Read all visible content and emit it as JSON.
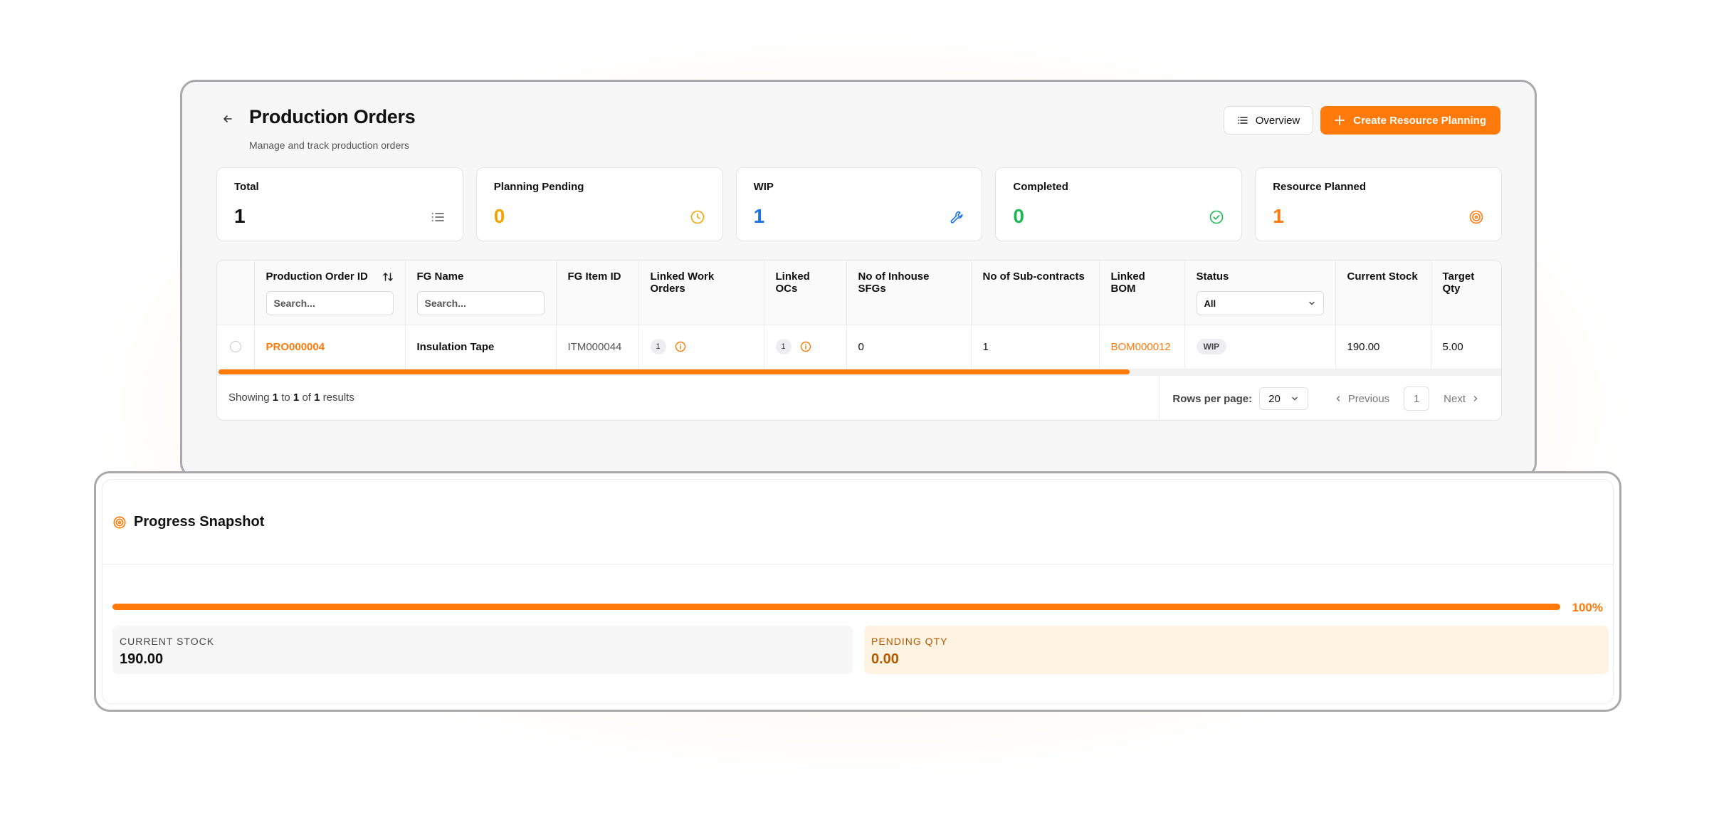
{
  "header": {
    "title": "Production Orders",
    "subtitle": "Manage and track production orders",
    "overview_label": "Overview",
    "create_label": "Create Resource Planning"
  },
  "stats": [
    {
      "label": "Total",
      "value": "1",
      "color": "#111111",
      "icon": "list-icon"
    },
    {
      "label": "Planning Pending",
      "value": "0",
      "color": "#f5a300",
      "icon": "clock-icon"
    },
    {
      "label": "WIP",
      "value": "1",
      "color": "#1a73e8",
      "icon": "wrench-icon"
    },
    {
      "label": "Completed",
      "value": "0",
      "color": "#1db954",
      "icon": "check-circle-icon"
    },
    {
      "label": "Resource Planned",
      "value": "1",
      "color": "#ff7a0a",
      "icon": "target-icon"
    }
  ],
  "table": {
    "columns": [
      "Production Order ID",
      "FG Name",
      "FG Item ID",
      "Linked Work Orders",
      "Linked OCs",
      "No of Inhouse SFGs",
      "No of Sub-contracts",
      "Linked BOM",
      "Status",
      "Current Stock",
      "Target Qty"
    ],
    "search_placeholder": "Search...",
    "status_filter": "All",
    "rows": [
      {
        "production_order_id": "PRO000004",
        "fg_name": "Insulation Tape",
        "fg_item_id": "ITM000044",
        "linked_work_orders": "1",
        "linked_ocs": "1",
        "inhouse_sfgs": "0",
        "sub_contracts": "1",
        "linked_bom": "BOM000012",
        "status": "WIP",
        "current_stock": "190.00",
        "target_qty": "5.00"
      }
    ]
  },
  "footer": {
    "showing_prefix": "Showing",
    "showing_from": "1",
    "showing_to_word": "to",
    "showing_to": "1",
    "showing_of_word": "of",
    "showing_total": "1",
    "showing_suffix": "results",
    "rows_per_page_label": "Rows per page:",
    "rows_per_page": "20",
    "previous_label": "Previous",
    "page": "1",
    "next_label": "Next"
  },
  "snapshot": {
    "title": "Progress Snapshot",
    "progress_percent": 100,
    "progress_label": "100%",
    "current_stock_label": "CURRENT STOCK",
    "current_stock_value": "190.00",
    "pending_qty_label": "PENDING QTY",
    "pending_qty_value": "0.00"
  }
}
